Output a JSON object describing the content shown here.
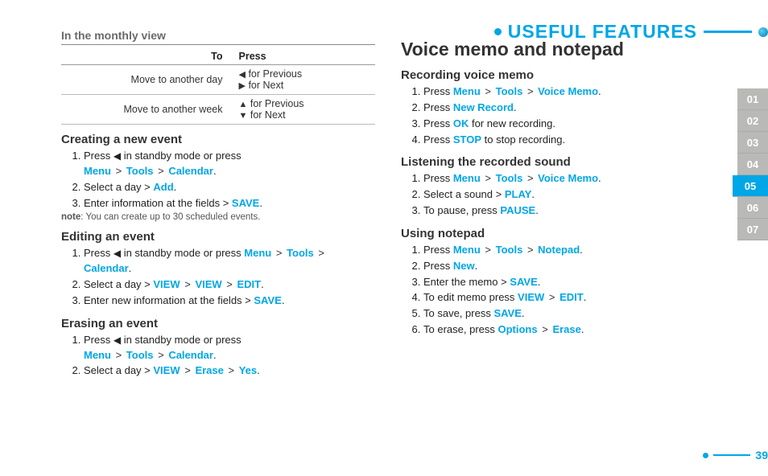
{
  "header": {
    "title": "Useful Features"
  },
  "tabs": [
    "01",
    "02",
    "03",
    "04",
    "05",
    "06",
    "07"
  ],
  "activeTab": "05",
  "pageNumber": "39",
  "left": {
    "monthlyView": {
      "heading": "In the monthly view",
      "thTo": "To",
      "thPress": "Press",
      "rows": [
        {
          "to": "Move to another day",
          "prev": "for Previous",
          "next": "for Next",
          "iconPrev": "◀",
          "iconNext": "▶"
        },
        {
          "to": "Move to another week",
          "prev": "for Previous",
          "next": "for Next",
          "iconPrev": "▲",
          "iconNext": "▼"
        }
      ]
    },
    "creating": {
      "heading": "Creating a new event",
      "step1_a": "Press ",
      "step1_icon": "◀",
      "step1_b": " in standby mode or press ",
      "menu": "Menu",
      "tools": "Tools",
      "calendar": "Calendar",
      "step2_a": "Select a day > ",
      "add": "Add",
      "step3_a": "Enter information at the fields > ",
      "save": "SAVE",
      "note_label": "note",
      "note_text": ": You can create up to 30 scheduled events."
    },
    "editing": {
      "heading": "Editing an event",
      "step1_a": "Press ",
      "step1_icon": "◀",
      "step1_b": " in standby mode or press ",
      "menu": "Menu",
      "tools": "Tools",
      "calendar": "Calendar",
      "step2_a": "Select a day > ",
      "view": "VIEW",
      "edit": "EDIT",
      "step3_a": "Enter new information at the fields > ",
      "save": "SAVE"
    },
    "erasing": {
      "heading": "Erasing an event",
      "step1_a": "Press ",
      "step1_icon": "◀",
      "step1_b": " in standby mode or press ",
      "menu": "Menu",
      "tools": "Tools",
      "calendar": "Calendar",
      "step2_a": "Select a day > ",
      "view": "VIEW",
      "erase": "Erase",
      "yes": "Yes"
    }
  },
  "right": {
    "title": "Voice memo and notepad",
    "recording": {
      "heading": "Recording voice memo",
      "s1a": "Press ",
      "menu": "Menu",
      "tools": "Tools",
      "vm": "Voice Memo",
      "s2a": "Press ",
      "newrec": "New Record",
      "s3a": "Press ",
      "ok": "OK",
      "s3b": " for new recording.",
      "s4a": "Press ",
      "stop": "STOP",
      "s4b": " to stop recording."
    },
    "listening": {
      "heading": "Listening the recorded sound",
      "s1a": "Press ",
      "menu": "Menu",
      "tools": "Tools",
      "vm": "Voice Memo",
      "s2a": "Select a sound > ",
      "play": "PLAY",
      "s3a": "To pause, press ",
      "pause": "PAUSE"
    },
    "notepad": {
      "heading": "Using notepad",
      "s1a": "Press ",
      "menu": "Menu",
      "tools": "Tools",
      "np": "Notepad",
      "s2a": "Press ",
      "new": "New",
      "s3a": "Enter the memo > ",
      "save": "SAVE",
      "s4a": "To edit memo press ",
      "view": "VIEW",
      "edit": "EDIT",
      "s5a": "To save, press ",
      "save2": "SAVE",
      "s6a": "To erase, press ",
      "options": "Options",
      "erase": "Erase"
    }
  }
}
